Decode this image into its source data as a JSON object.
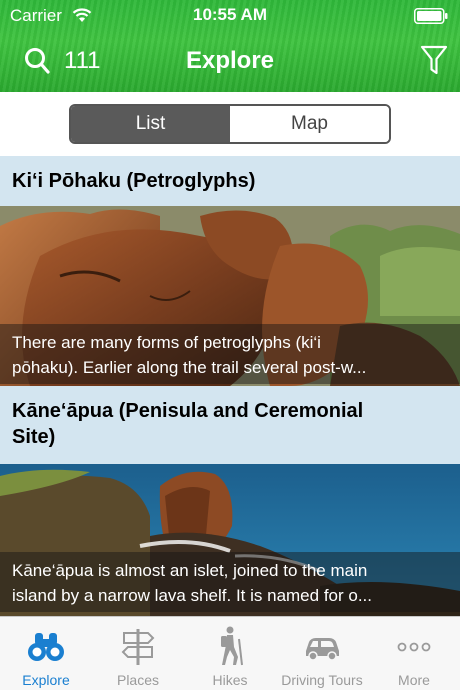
{
  "status_bar": {
    "carrier": "Carrier",
    "time": "10:55 AM"
  },
  "nav": {
    "result_count": "111",
    "title": "Explore"
  },
  "segment": {
    "list_label": "List",
    "map_label": "Map",
    "selected": "List"
  },
  "places": [
    {
      "title": "Ki‘i Pōhaku (Petroglyphs)",
      "desc_line1": "There are many forms of petroglyphs (ki‘i",
      "desc_line2": "pōhaku). Earlier along the trail several post-w..."
    },
    {
      "title_line1": "Kāne‘āpua (Penisula and Ceremonial",
      "title_line2": "Site)",
      "desc_line1": "Kāne‘āpua is almost an islet, joined to the main",
      "desc_line2": "island by a narrow lava shelf. It is named for o..."
    }
  ],
  "tabs": [
    {
      "label": "Explore",
      "icon": "binoculars-icon",
      "active": true
    },
    {
      "label": "Places",
      "icon": "signpost-icon",
      "active": false
    },
    {
      "label": "Hikes",
      "icon": "hiker-icon",
      "active": false
    },
    {
      "label": "Driving Tours",
      "icon": "car-icon",
      "active": false
    },
    {
      "label": "More",
      "icon": "more-dots-icon",
      "active": false
    }
  ],
  "colors": {
    "header_green": "#35b83b",
    "tab_active": "#1a7fd0",
    "card_title_bg": "#d3e5f0"
  }
}
